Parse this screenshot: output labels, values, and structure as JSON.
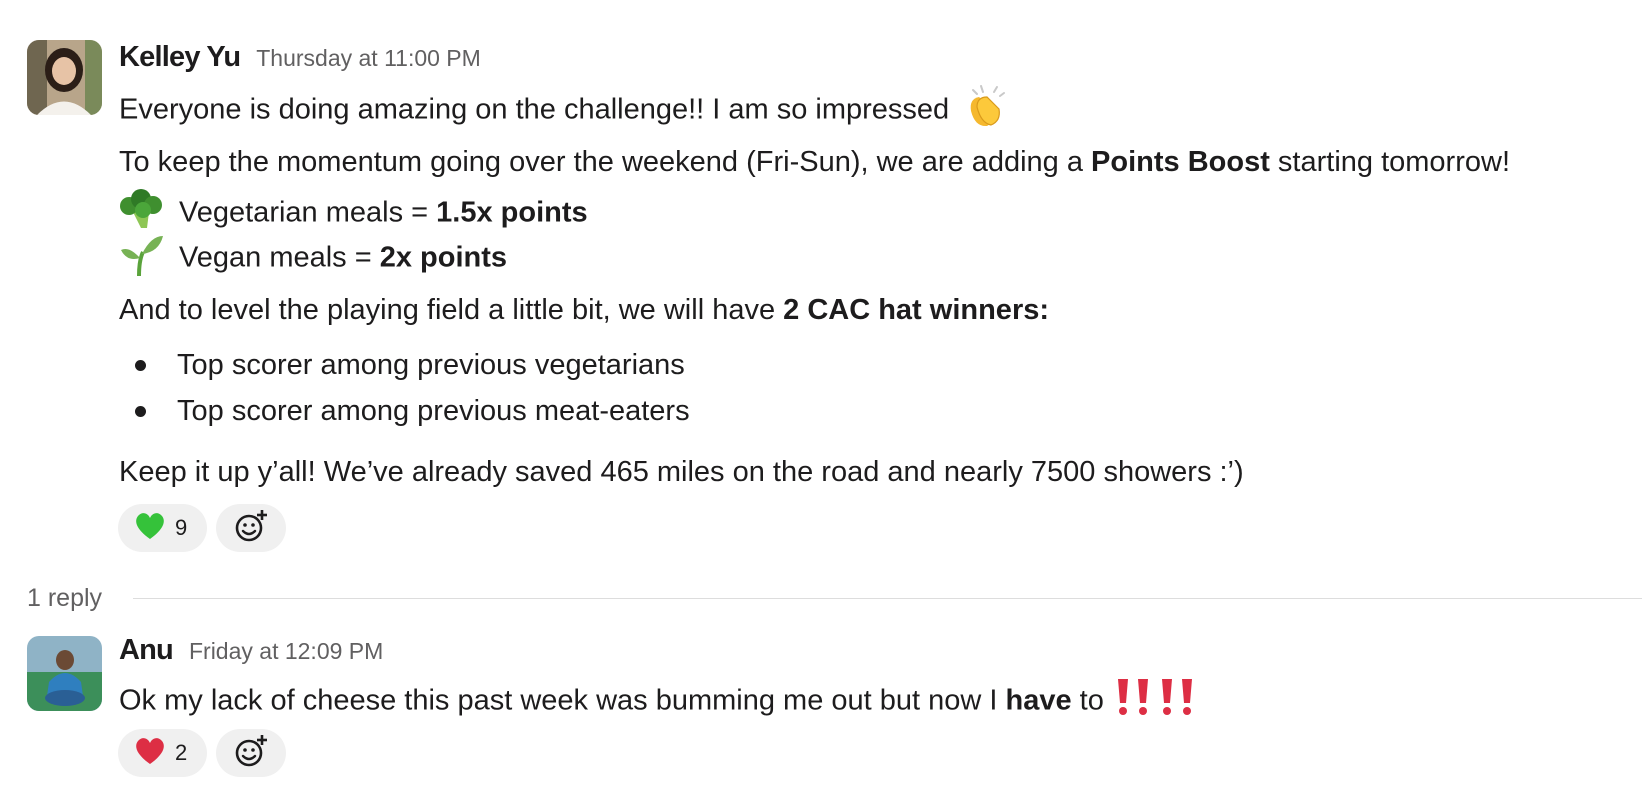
{
  "messages": [
    {
      "author": "Kelley Yu",
      "timestamp": "Thursday at 11:00 PM",
      "line1": {
        "text": "Everyone is doing amazing on the challenge!! I am so impressed",
        "emoji": "clapping-hands"
      },
      "line2": {
        "pre": "To keep the momentum going over the weekend (Fri-Sun), we are adding a ",
        "bold": "Points Boost",
        "post": " starting tomorrow!"
      },
      "boost_items": [
        {
          "emoji": "broccoli",
          "text": "Vegetarian meals = ",
          "bold": "1.5x points"
        },
        {
          "emoji": "seedling",
          "text": "Vegan meals = ",
          "bold": "2x points"
        }
      ],
      "line3": {
        "pre": "And to level the playing field a little bit, we will have ",
        "bold": "2 CAC hat winners:"
      },
      "bullets": [
        "Top scorer among previous vegetarians",
        "Top scorer among previous meat-eaters"
      ],
      "line4": "Keep it up y’all! We’ve already saved 465 miles on the road and nearly 7500 showers :’)",
      "reaction": {
        "emoji": "green-heart",
        "count": "9"
      }
    },
    {
      "author": "Anu",
      "timestamp": "Friday at 12:09 PM",
      "text": {
        "pre": "Ok my lack of cheese this past week was bumming me out but now I ",
        "bold": "have",
        "post": " to "
      },
      "trailing_emoji": [
        "double-exclamation-mark",
        "double-exclamation-mark"
      ],
      "reaction": {
        "emoji": "red-heart",
        "count": "2"
      }
    }
  ],
  "thread": {
    "reply_count_label": "1 reply"
  },
  "colors": {
    "green_heart": "#35c23a",
    "red_heart": "#dd2e44",
    "exclamation": "#dd2e44",
    "reaction_bg": "#f0f0f0"
  }
}
